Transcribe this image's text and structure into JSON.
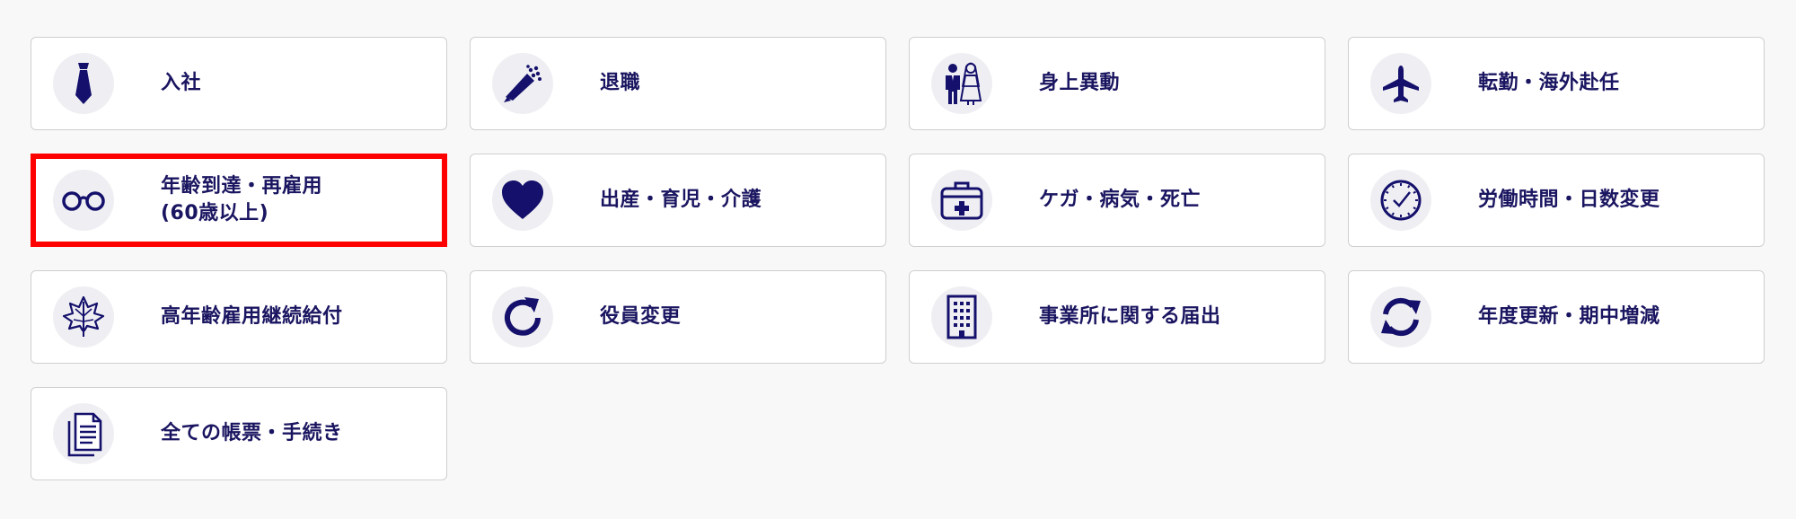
{
  "colors": {
    "icon": "#14106b",
    "text": "#1a1560",
    "icon_bg": "#efeff3",
    "border": "#cfcfcf",
    "highlight": "#ff0000",
    "background": "#f8f8f8"
  },
  "cards": [
    {
      "icon": "necktie-icon",
      "lines": [
        "入社"
      ]
    },
    {
      "icon": "bouquet-icon",
      "lines": [
        "退職"
      ]
    },
    {
      "icon": "wedding-couple-icon",
      "lines": [
        "身上異動"
      ]
    },
    {
      "icon": "airplane-icon",
      "lines": [
        "転勤・海外赴任"
      ]
    },
    {
      "icon": "glasses-icon",
      "lines": [
        "年齢到達・再雇用",
        "(60歳以上)"
      ],
      "selected": true
    },
    {
      "icon": "heart-icon",
      "lines": [
        "出産・育児・介護"
      ]
    },
    {
      "icon": "first-aid-kit-icon",
      "lines": [
        "ケガ・病気・死亡"
      ]
    },
    {
      "icon": "clock-icon",
      "lines": [
        "労働時間・日数変更"
      ]
    },
    {
      "icon": "maple-leaf-icon",
      "lines": [
        "高年齢雇用継続給付"
      ]
    },
    {
      "icon": "rotate-arrow-icon",
      "lines": [
        "役員変更"
      ]
    },
    {
      "icon": "office-building-icon",
      "lines": [
        "事業所に関する届出"
      ]
    },
    {
      "icon": "sync-arrows-icon",
      "lines": [
        "年度更新・期中増減"
      ]
    },
    {
      "icon": "documents-icon",
      "lines": [
        "全ての帳票・手続き"
      ]
    }
  ]
}
